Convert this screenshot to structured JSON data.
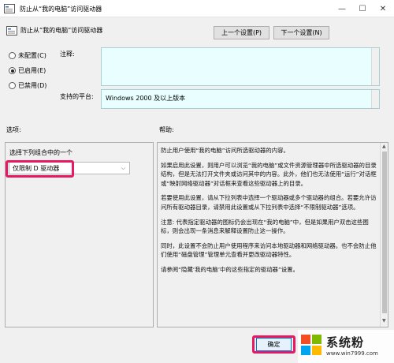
{
  "window": {
    "title": "防止从“我的电脑”访问驱动器",
    "minimize_glyph": "—",
    "maximize_glyph": "☐",
    "close_glyph": "✕"
  },
  "header": {
    "policy_name": "防止从“我的电脑”访问驱动器",
    "prev_setting_label": "上一个设置(P)",
    "next_setting_label": "下一个设置(N)"
  },
  "state": {
    "options": [
      {
        "label": "未配置(C)",
        "checked": false
      },
      {
        "label": "已启用(E)",
        "checked": true
      },
      {
        "label": "已禁用(D)",
        "checked": false
      }
    ]
  },
  "comment": {
    "label": "注释:",
    "value": ""
  },
  "platform": {
    "label": "支持的平台:",
    "value": "Windows 2000 及以上版本"
  },
  "options_section": {
    "label": "选项:",
    "combo_caption": "选择下列组合中的一个",
    "combo_value": "仅限制 D 驱动器"
  },
  "help_section": {
    "label": "帮助:",
    "paragraphs": [
      "防止用户使用“我的电脑”访问所选驱动器的内容。",
      "如果启用此设置，则用户可以浏览“我的电脑”或文件资源管理器中所选驱动器的目录结构，但是无法打开文件夹或访问其中的内容。此外，他们也无法使用“运行”对话框或“映射网络驱动器”对话框来查看这些驱动器上的目录。",
      "若要使用此设置，请从下拉列表中选择一个驱动器或多个驱动器的组合。若要允许访问所有驱动器目录，请禁用此设置或从下拉列表中选择“不限制驱动器”选项。",
      "注意: 代表指定驱动器的图标仍会出现在“我的电脑”中，但是如果用户双击这些图标，则会出现一条消息来解释设置防止这一操作。",
      " 同时，此设置不会防止用户使用程序来访问本地驱动器和网络驱动器。也不会防止他们使用“磁盘管理”管理单元查看并更改驱动器特性。",
      "请参阅“隐藏‘我的电脑’中的这些指定的驱动器”设置。"
    ]
  },
  "footer": {
    "ok_label": "确定"
  },
  "watermark": {
    "text": "系统粉",
    "url": "www.win7999.com"
  },
  "colors": {
    "highlight": "#e61a63",
    "field_bg": "#e9ffff"
  }
}
